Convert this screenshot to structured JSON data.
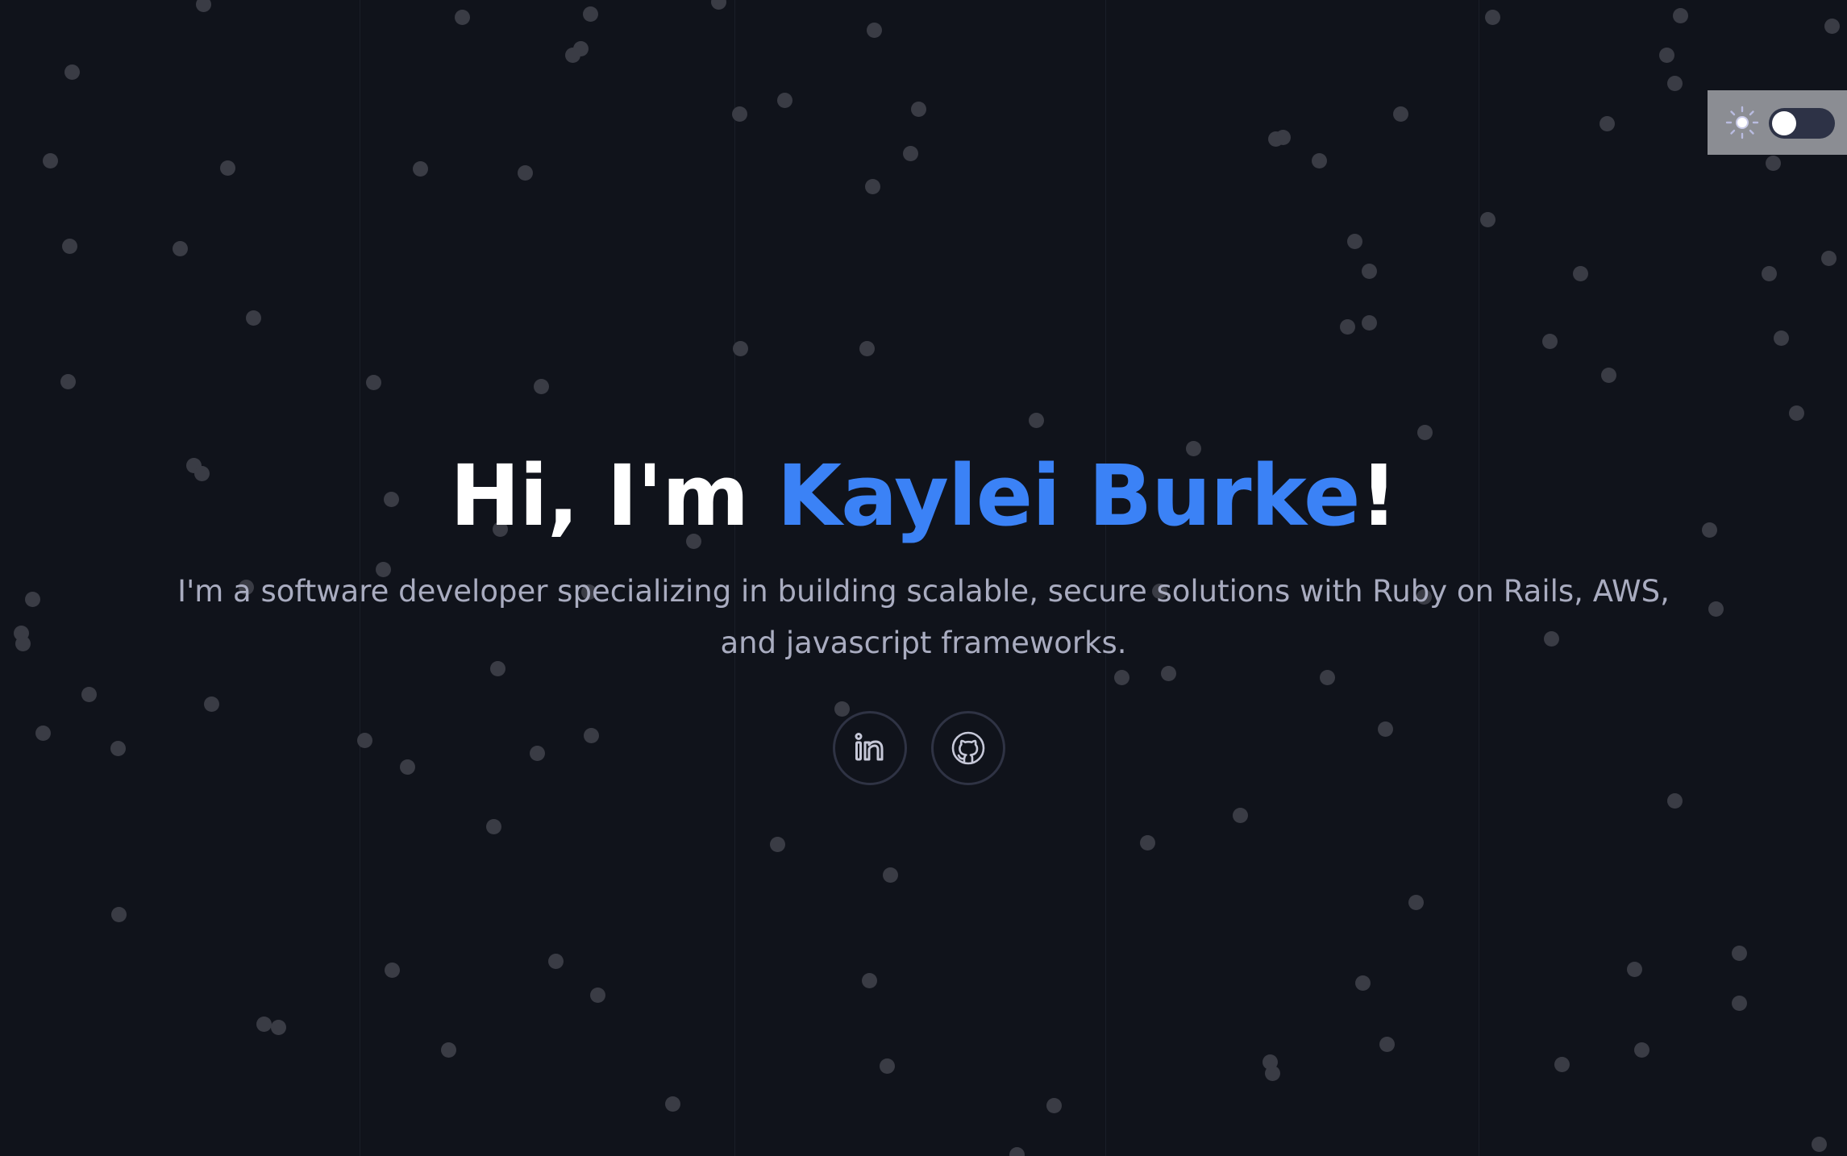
{
  "theme_toggle": {
    "icon": "sun-icon",
    "state": "off"
  },
  "hero": {
    "greeting": "Hi, I'm ",
    "name": "Kaylei Burke",
    "punctuation": "!",
    "subtitle": "I'm a software developer specializing in building scalable, secure solutions with Ruby on Rails, AWS, and javascript frameworks."
  },
  "socials": [
    {
      "icon": "linkedin-icon"
    },
    {
      "icon": "github-icon"
    }
  ],
  "colors": {
    "background": "#10131b",
    "accent": "#3b82f6",
    "heading": "#ffffff",
    "subtitle": "#a9acc0",
    "dot": "#3a3c45",
    "toggle_panel": "#8b8d93"
  }
}
